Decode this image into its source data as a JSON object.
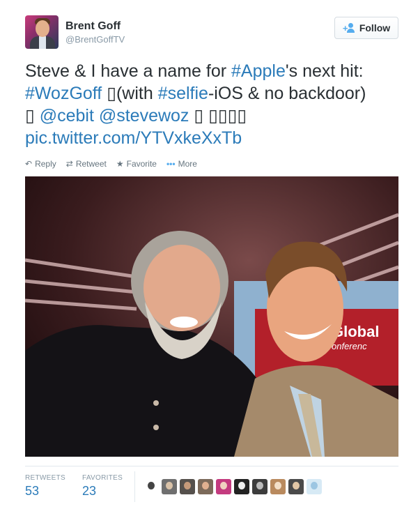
{
  "user": {
    "display_name": "Brent Goff",
    "handle": "@BrentGoffTV"
  },
  "follow_button": {
    "label": "Follow",
    "icon": "add-user-icon"
  },
  "tweet": {
    "text_part1": "Steve & I have a name for ",
    "hashtag_apple": "#Apple",
    "text_part2": "'s next hit: ",
    "hashtag_wozgoff": "#WozGoff",
    "glyph1": " ▯",
    "text_part3": "(with ",
    "hashtag_selfie": "#selfie",
    "text_part4": "-iOS & no backdoor)",
    "glyph2": "▯ ",
    "mention_cebit": "@cebit",
    "mention_stevewoz": "@stevewoz",
    "glyph3": " ▯ ▯▯▯▯",
    "pic_link": "pic.twitter.com/YTVxkeXxTb"
  },
  "actions": {
    "reply": "Reply",
    "retweet": "Retweet",
    "favorite": "Favorite",
    "more": "More"
  },
  "photo": {
    "sign_text_1": "Global",
    "sign_text_2": "onferenc"
  },
  "stats": {
    "retweets_label": "RETWEETS",
    "retweets_value": "53",
    "favorites_label": "FAVORITES",
    "favorites_value": "23"
  },
  "colors": {
    "link": "#2b7bb9",
    "muted": "#8899a6",
    "accent": "#55acee"
  }
}
